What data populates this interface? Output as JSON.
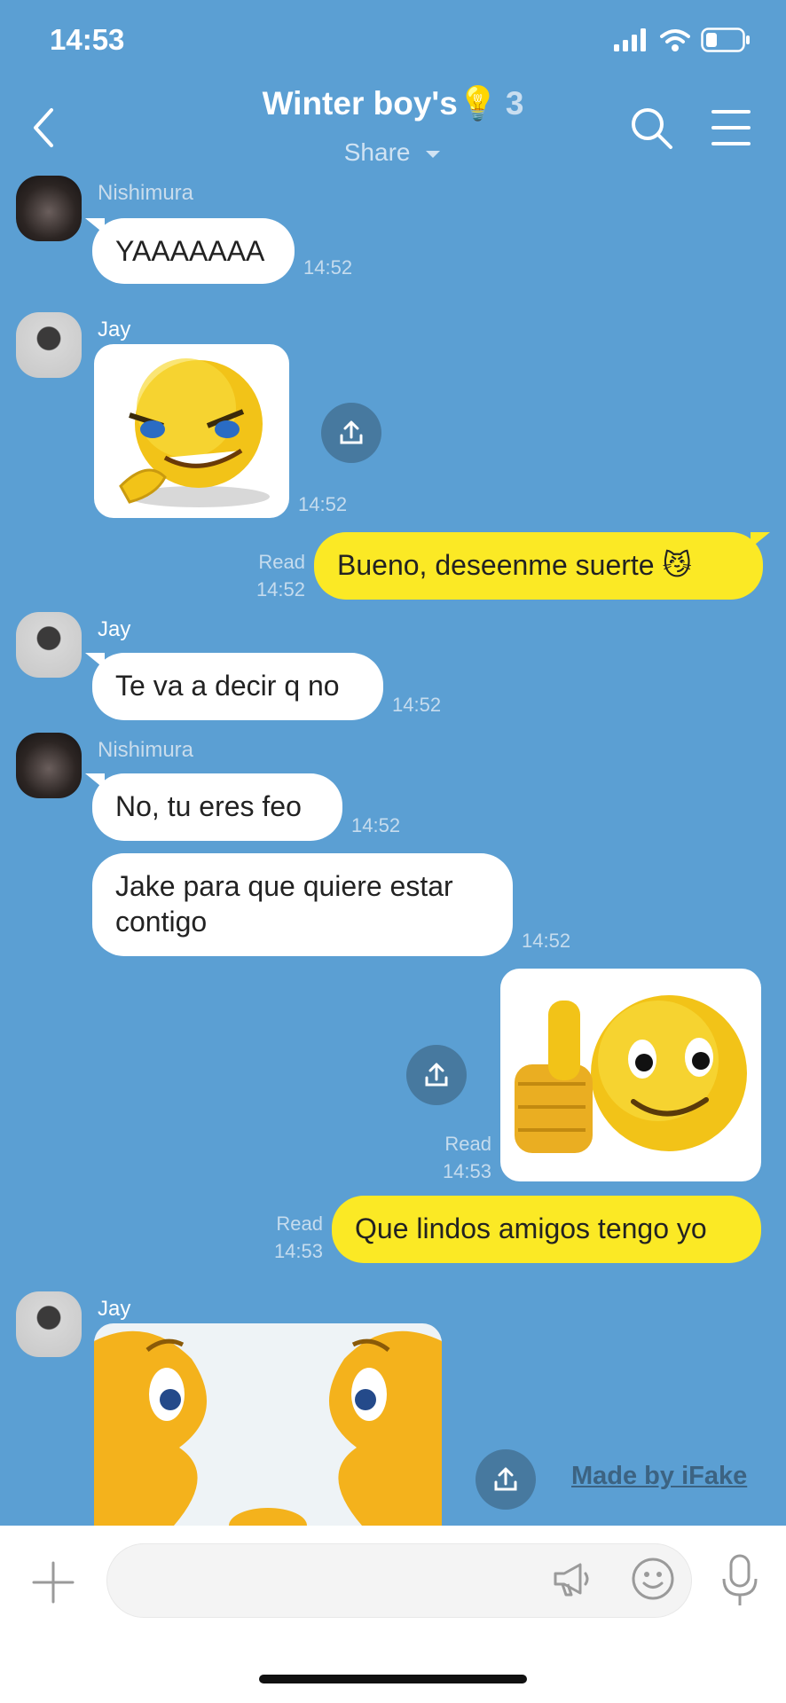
{
  "status": {
    "time": "14:53"
  },
  "header": {
    "title": "Winter boy's",
    "title_emoji": "💡",
    "member_count": "3",
    "subtitle": "Share",
    "icons": [
      "back-icon",
      "search-icon",
      "menu-icon"
    ]
  },
  "messages": {
    "m1": {
      "sender": "Nishimura",
      "text": "YAAAAAAA",
      "time": "14:52"
    },
    "m2": {
      "sender": "Jay",
      "sticker": "grinning-emoji-sticker",
      "time": "14:52"
    },
    "m3": {
      "status": "Read",
      "text": "Bueno, deseenme suerte 😼",
      "time": "14:52"
    },
    "m4": {
      "sender": "Jay",
      "text": "Te va a decir q no",
      "time": "14:52"
    },
    "m5": {
      "sender": "Nishimura",
      "text": "No, tu eres feo",
      "time": "14:52"
    },
    "m6": {
      "text": "Jake para que quiere estar contigo",
      "time": "14:52"
    },
    "m7": {
      "status": "Read",
      "sticker": "thumbs-up-emoji-sticker",
      "time": "14:53"
    },
    "m8": {
      "status": "Read",
      "text": "Que lindos amigos tengo yo",
      "time": "14:53"
    },
    "m9": {
      "sender": "Jay",
      "sticker": "two-faces-emoji-sticker"
    }
  },
  "watermark": "Made by iFake",
  "input": {
    "placeholder": "",
    "icons": [
      "plus-icon",
      "megaphone-icon",
      "emoji-icon",
      "microphone-icon"
    ]
  },
  "colors": {
    "background": "#5b9fd3",
    "my_bubble": "#fbe925",
    "their_bubble": "#ffffff",
    "share_button": "#47799f"
  }
}
